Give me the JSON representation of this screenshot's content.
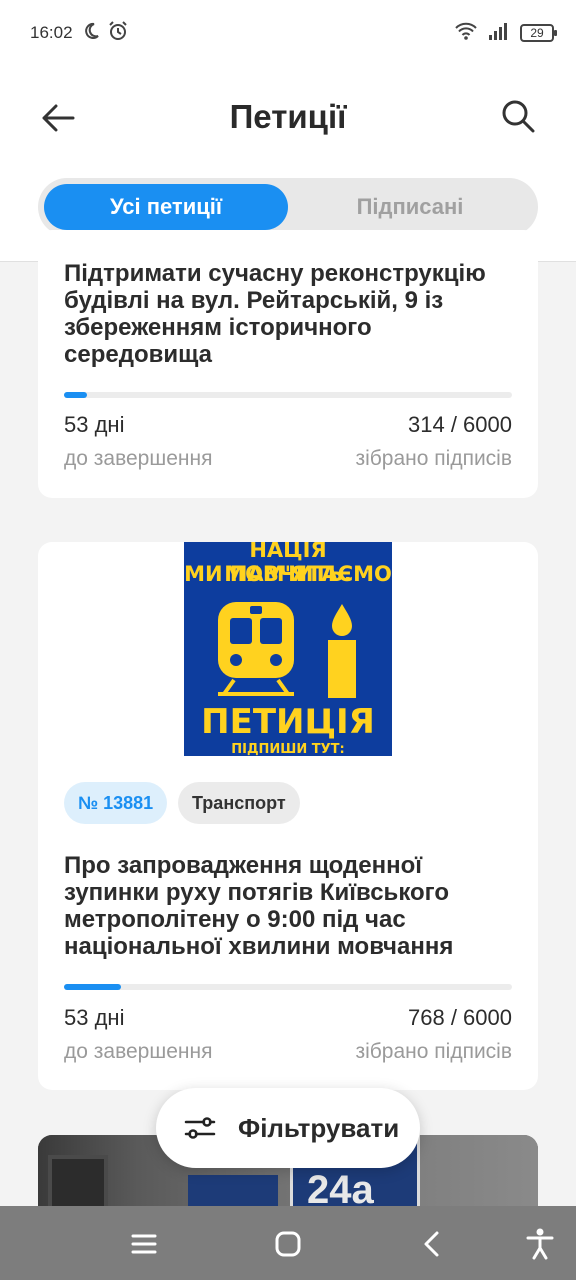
{
  "status_bar": {
    "time": "16:02",
    "battery": "29"
  },
  "header": {
    "title": "Петиції"
  },
  "tabs": [
    {
      "label": "Усі петиції",
      "active": true
    },
    {
      "label": "Підписані",
      "active": false
    }
  ],
  "petitions": [
    {
      "title": "Підтримати сучасну реконструкцію будівлі на вул. Рейтарській, 9 із збереженням історичного середовища",
      "progress": 0.052,
      "days": "53 дні",
      "days_label": "до завершення",
      "signatures": "314 / 6000",
      "signatures_label": "зібрано підписів"
    },
    {
      "poster": {
        "line1": "НАЦІЯ МОВЧИТЬ.",
        "line2": "МИ ПАМ'ЯТАЄМО",
        "line3": "ПЕТИЦІЯ",
        "line4": "ПІДПИШИ ТУТ:"
      },
      "number": "№ 13881",
      "category": "Транспорт",
      "title": "Про запровадження щоденної зупинки руху потягів Київського метрополітену о 9:00 під час національної хвилини мовчання",
      "progress": 0.128,
      "days": "53 дні",
      "days_label": "до завершення",
      "signatures": "768 / 6000",
      "signatures_label": "зібрано підписів"
    }
  ],
  "partial_card": {
    "sign_text": "24а"
  },
  "filter_button": {
    "label": "Фільтрувати"
  },
  "colors": {
    "accent": "#1a8ff2",
    "poster_bg": "#0d3d9e",
    "poster_text": "#ffd21f"
  }
}
